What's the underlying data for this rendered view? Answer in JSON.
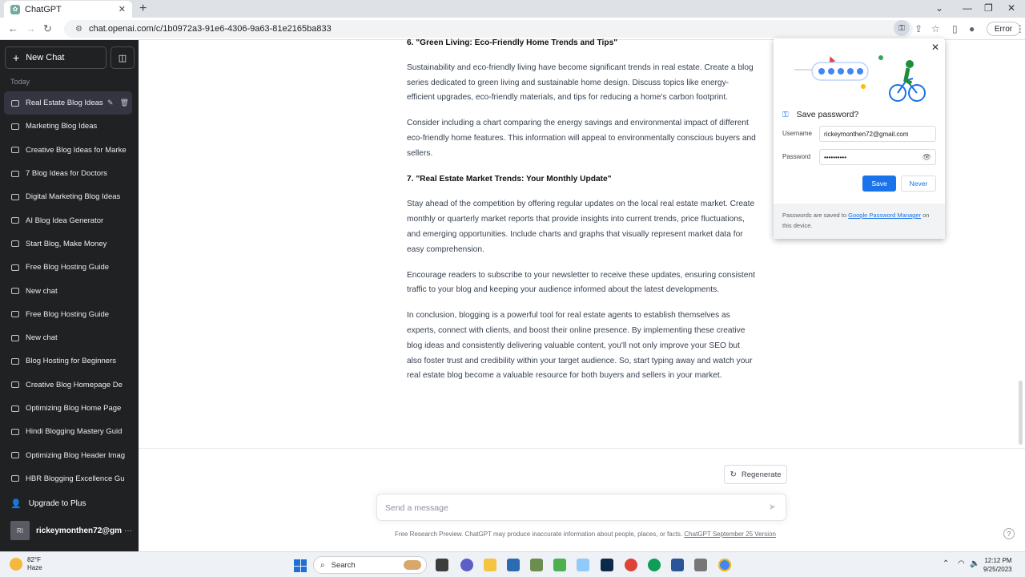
{
  "browser": {
    "tab_title": "ChatGPT",
    "tab_close": "✕",
    "new_tab": "+",
    "url": "chat.openai.com/c/1b0972a3-91e6-4306-9a63-81e2165ba833",
    "error_label": "Error"
  },
  "sidebar": {
    "new_chat_label": "New Chat",
    "section_today": "Today",
    "items": [
      {
        "label": "Real Estate Blog Ideas",
        "active": true
      },
      {
        "label": "Marketing Blog Ideas"
      },
      {
        "label": "Creative Blog Ideas for Marke"
      },
      {
        "label": "7 Blog Ideas for Doctors"
      },
      {
        "label": "Digital Marketing Blog Ideas"
      },
      {
        "label": "AI Blog Idea Generator"
      },
      {
        "label": "Start Blog, Make Money"
      },
      {
        "label": "Free Blog Hosting Guide"
      },
      {
        "label": "New chat"
      },
      {
        "label": "Free Blog Hosting Guide"
      },
      {
        "label": "New chat"
      },
      {
        "label": "Blog Hosting for Beginners"
      },
      {
        "label": "Creative Blog Homepage De"
      },
      {
        "label": "Optimizing Blog Home Page"
      },
      {
        "label": "Hindi Blogging Mastery Guid"
      },
      {
        "label": "Optimizing Blog Header Imag"
      },
      {
        "label": "HBR Blogging Excellence Gu"
      }
    ],
    "upgrade_label": "Upgrade to Plus",
    "avatar_initials": "RI",
    "username": "rickeymonthen72@gm"
  },
  "chat": {
    "heading6": "6. \"Green Living: Eco-Friendly Home Trends and Tips\"",
    "p6a": "Sustainability and eco-friendly living have become significant trends in real estate. Create a blog series dedicated to green living and sustainable home design. Discuss topics like energy-efficient upgrades, eco-friendly materials, and tips for reducing a home's carbon footprint.",
    "p6b": "Consider including a chart comparing the energy savings and environmental impact of different eco-friendly home features. This information will appeal to environmentally conscious buyers and sellers.",
    "heading7": "7. \"Real Estate Market Trends: Your Monthly Update\"",
    "p7a": "Stay ahead of the competition by offering regular updates on the local real estate market. Create monthly or quarterly market reports that provide insights into current trends, price fluctuations, and emerging opportunities. Include charts and graphs that visually represent market data for easy comprehension.",
    "p7b": "Encourage readers to subscribe to your newsletter to receive these updates, ensuring consistent traffic to your blog and keeping your audience informed about the latest developments.",
    "conclusion": "In conclusion, blogging is a powerful tool for real estate agents to establish themselves as experts, connect with clients, and boost their online presence. By implementing these creative blog ideas and consistently delivering valuable content, you'll not only improve your SEO but also foster trust and credibility within your target audience. So, start typing away and watch your real estate blog become a valuable resource for both buyers and sellers in your market.",
    "regenerate_label": "Regenerate",
    "input_placeholder": "Send a message",
    "disclaimer": "Free Research Preview. ChatGPT may produce inaccurate information about people, places, or facts.",
    "disclaimer_link": "ChatGPT September 25 Version",
    "help": "?"
  },
  "password_popup": {
    "title": "Save password?",
    "username_label": "Username",
    "username_value": "rickeymonthen72@gmail.com",
    "password_label": "Password",
    "password_value": "••••••••••",
    "save_label": "Save",
    "never_label": "Never",
    "footer_prefix": "Passwords are saved to ",
    "footer_link": "Google Password Manager",
    "footer_suffix": " on this device."
  },
  "taskbar": {
    "temperature": "82°F",
    "condition": "Haze",
    "search_label": "Search",
    "time": "12:12 PM",
    "date": "9/25/2023"
  },
  "colors": {
    "sidebar_bg": "#202123",
    "accent_blue": "#1a73e8"
  }
}
